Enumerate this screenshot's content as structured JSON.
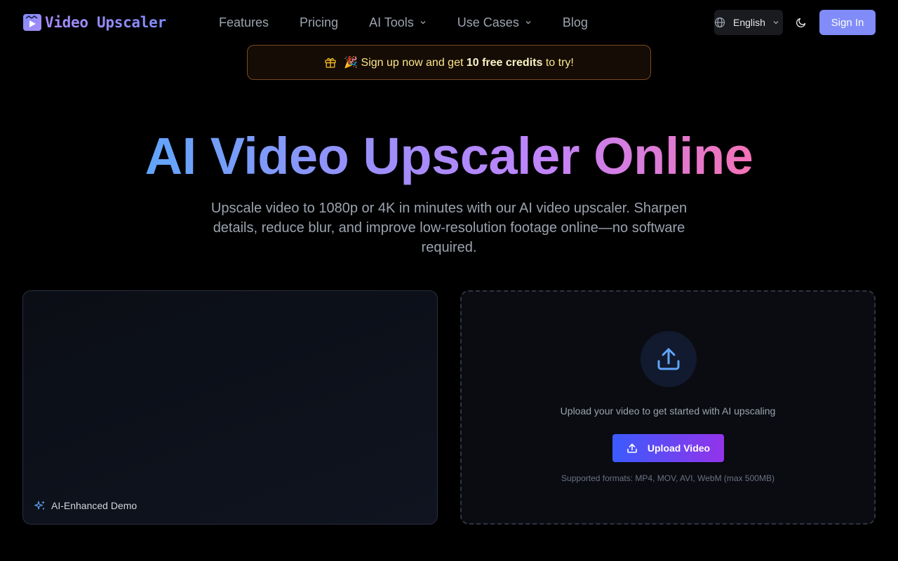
{
  "header": {
    "logo_text": "Video Upscaler",
    "nav": [
      {
        "label": "Features",
        "has_dropdown": false
      },
      {
        "label": "Pricing",
        "has_dropdown": false
      },
      {
        "label": "AI Tools",
        "has_dropdown": true
      },
      {
        "label": "Use Cases",
        "has_dropdown": true
      },
      {
        "label": "Blog",
        "has_dropdown": false
      }
    ],
    "language": "English",
    "sign_in": "Sign In"
  },
  "banner": {
    "emoji": "🎉",
    "before": "Sign up now and get",
    "highlight": "10 free credits",
    "after": "to try!"
  },
  "hero": {
    "title": "AI Video Upscaler Online",
    "subtitle": "Upscale video to 1080p or 4K in minutes with our AI video upscaler. Sharpen details, reduce blur, and improve low-resolution footage online—no software required."
  },
  "demo": {
    "label": "AI-Enhanced Demo"
  },
  "upload": {
    "prompt": "Upload your video to get started with AI upscaling",
    "button": "Upload Video",
    "formats": "Supported formats: MP4, MOV, AVI, WebM (max 500MB)"
  },
  "colors": {
    "accent": "#818cf8",
    "background": "#000000",
    "gradient_start": "#60a5fa",
    "gradient_end": "#f472b6",
    "banner_border": "#7c4a1e"
  },
  "icons": {
    "logo": "video-play-icon",
    "language": "globe-icon",
    "theme": "moon-icon",
    "banner": "gift-icon",
    "demo": "sparkles-icon",
    "upload": "upload-icon"
  }
}
